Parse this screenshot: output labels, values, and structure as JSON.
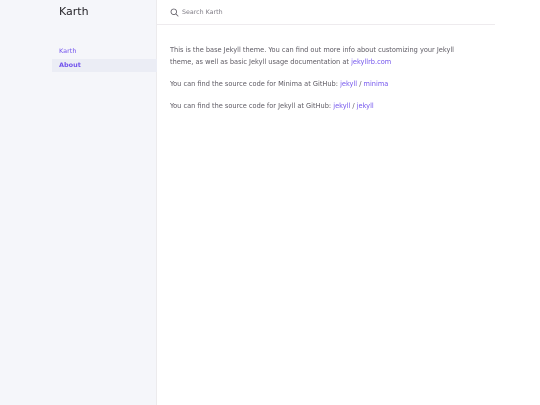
{
  "site": {
    "title": "Karth"
  },
  "nav": {
    "items": [
      {
        "label": "Karth",
        "active": false
      },
      {
        "label": "About",
        "active": true
      }
    ]
  },
  "search": {
    "placeholder": "Search Karth"
  },
  "content": {
    "p1_text": "This is the base Jekyll theme. You can find out more info about customizing your Jekyll theme, as well as basic Jekyll usage documentation at ",
    "p1_link": "jekyllrb.com",
    "p2_text": "You can find the source code for Minima at GitHub: ",
    "p2_link_a": "jekyll",
    "p2_sep": " / ",
    "p2_link_b": "minima",
    "p3_text": "You can find the source code for Jekyll at GitHub: ",
    "p3_link_a": "jekyll",
    "p3_sep": " / ",
    "p3_link_b": "jekyll"
  },
  "colors": {
    "accent": "#7253ed",
    "sidebar_bg": "#f5f6fa",
    "active_bg": "#ebedf5",
    "text": "#5c5962"
  },
  "icons": {
    "search": "search-icon"
  }
}
